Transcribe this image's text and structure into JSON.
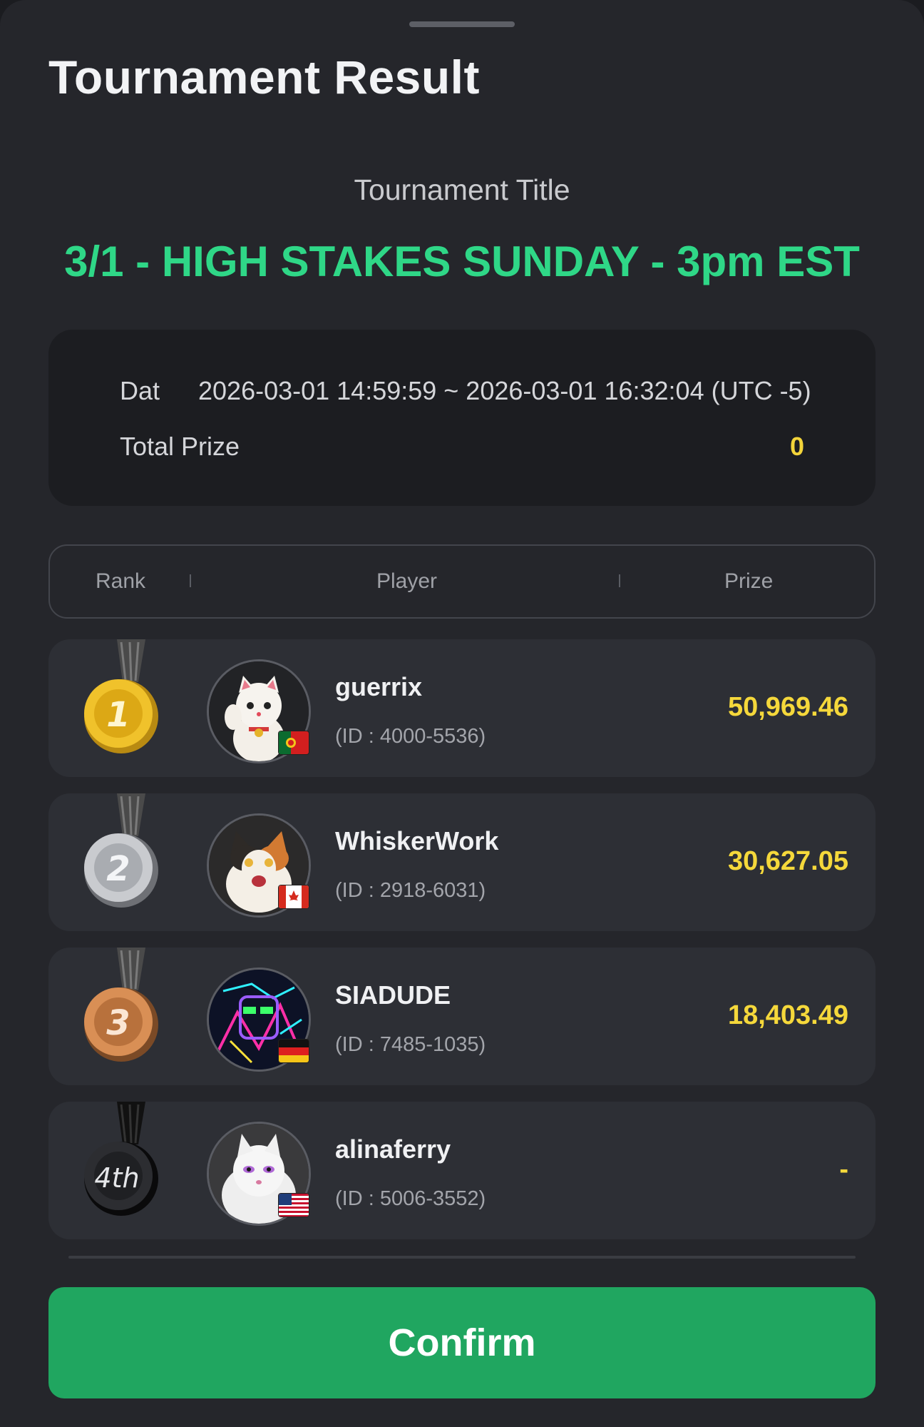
{
  "sheet": {
    "title": "Tournament Result"
  },
  "tournament": {
    "title_label": "Tournament Title",
    "name": "3/1 - HIGH STAKES SUNDAY - 3pm EST"
  },
  "info": {
    "date_label": "Dat",
    "date_value": "2026-03-01 14:59:59 ~ 2026-03-01 16:32:04 (UTC -5)",
    "total_prize_label": "Total Prize",
    "total_prize_value": "0"
  },
  "table": {
    "headers": {
      "rank": "Rank",
      "player": "Player",
      "prize": "Prize"
    },
    "rows": [
      {
        "rank": "1",
        "medal": "gold-medal-icon",
        "name": "guerrix",
        "id": "(ID : 4000-5536)",
        "prize": "50,969.46",
        "flag": "portugal-flag-icon",
        "avatar": "lucky-cat-avatar"
      },
      {
        "rank": "2",
        "medal": "silver-medal-icon",
        "name": "WhiskerWork",
        "id": "(ID : 2918-6031)",
        "prize": "30,627.05",
        "flag": "canada-flag-icon",
        "avatar": "calico-cat-avatar"
      },
      {
        "rank": "3",
        "medal": "bronze-medal-icon",
        "name": "SIADUDE",
        "id": "(ID : 7485-1035)",
        "prize": "18,403.49",
        "flag": "germany-flag-icon",
        "avatar": "neon-avatar"
      },
      {
        "rank": "4th",
        "medal": "black-medal-icon",
        "name": "alinaferry",
        "id": "(ID : 5006-3552)",
        "prize": "-",
        "flag": "usa-flag-icon",
        "avatar": "white-cat-avatar"
      }
    ]
  },
  "confirm_label": "Confirm",
  "colors": {
    "accent_green": "#2fd787",
    "button_green": "#20a660",
    "prize_yellow": "#f5d83b"
  }
}
